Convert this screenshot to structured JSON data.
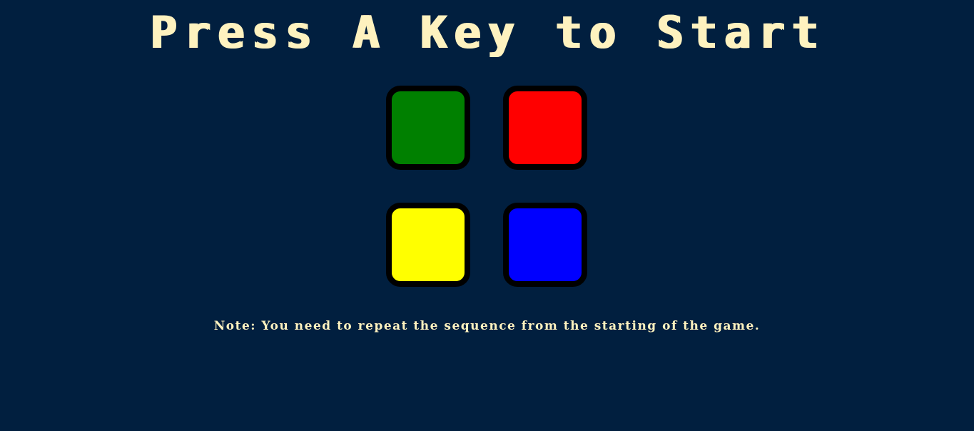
{
  "title": "Press A Key to Start",
  "note": "Note: You need to repeat the sequence from the starting of the game.",
  "colors": {
    "background": "#011F3F",
    "text": "#FEF2BF",
    "border": "#000000"
  },
  "buttons": [
    {
      "id": "green",
      "color": "#008000"
    },
    {
      "id": "red",
      "color": "#FF0000"
    },
    {
      "id": "yellow",
      "color": "#FFFF00"
    },
    {
      "id": "blue",
      "color": "#0000FF"
    }
  ]
}
